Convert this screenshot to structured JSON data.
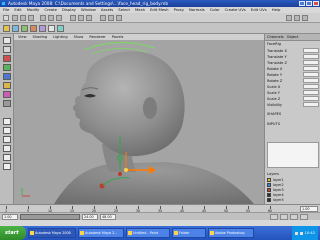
{
  "window": {
    "title": "Autodesk Maya 2008: C:\\Documents and Settings\\...\\face_head_rig_body.mb"
  },
  "menubar": {
    "items": [
      "File",
      "Edit",
      "Modify",
      "Create",
      "Display",
      "Window",
      "Assets",
      "Select",
      "Mesh",
      "Edit Mesh",
      "Proxy",
      "Normals",
      "Color",
      "Create UVs",
      "Edit UVs",
      "Help"
    ]
  },
  "viewport": {
    "menu": [
      "View",
      "Shading",
      "Lighting",
      "Show",
      "Renderer",
      "Panels"
    ]
  },
  "channel_box": {
    "tabs": [
      "Channels",
      "Object"
    ],
    "header": "FaceRig",
    "rows": [
      {
        "label": "Translate X"
      },
      {
        "label": "Translate Y"
      },
      {
        "label": "Translate Z"
      },
      {
        "label": "Rotate X"
      },
      {
        "label": "Rotate Y"
      },
      {
        "label": "Rotate Z"
      },
      {
        "label": "Scale X"
      },
      {
        "label": "Scale Y"
      },
      {
        "label": "Scale Z"
      },
      {
        "label": "Visibility"
      }
    ],
    "section_shapes": "SHAPES",
    "section_inputs": "INPUTS",
    "layers_label": "Layers",
    "layers": [
      {
        "name": "layer1",
        "color": "#d8c53b"
      },
      {
        "name": "layer2",
        "color": "#3e7ed8"
      },
      {
        "name": "layer3",
        "color": "#c23a3a"
      },
      {
        "name": "layer4",
        "color": "#2e2e2e"
      },
      {
        "name": "layer5",
        "color": "#2e2e2e"
      }
    ]
  },
  "timeline": {
    "ticks": [
      "1",
      "5",
      "10",
      "15",
      "20",
      "25",
      "30",
      "35",
      "40",
      "45",
      "50",
      "55",
      "60"
    ],
    "current_frame": "1.00"
  },
  "range": {
    "start": "1.00",
    "end": "24.00",
    "end2": "48.00"
  },
  "help_line": "",
  "taskbar": {
    "start_label": "start",
    "tasks": [
      {
        "label": "Autodesk Maya 2008"
      },
      {
        "label": "Autodesk Maya 2..."
      },
      {
        "label": "Untitled - Paint"
      },
      {
        "label": "Folder"
      },
      {
        "label": "Adobe Photoshop"
      }
    ],
    "clock": "10:42"
  },
  "colors": {
    "viewport_bg": "#a4a4a4",
    "skin": "#8d8d8d",
    "manip_orange": "#ff7a00",
    "joint_green": "#2fa84a",
    "ctrl_curve": "#7ed36b"
  }
}
